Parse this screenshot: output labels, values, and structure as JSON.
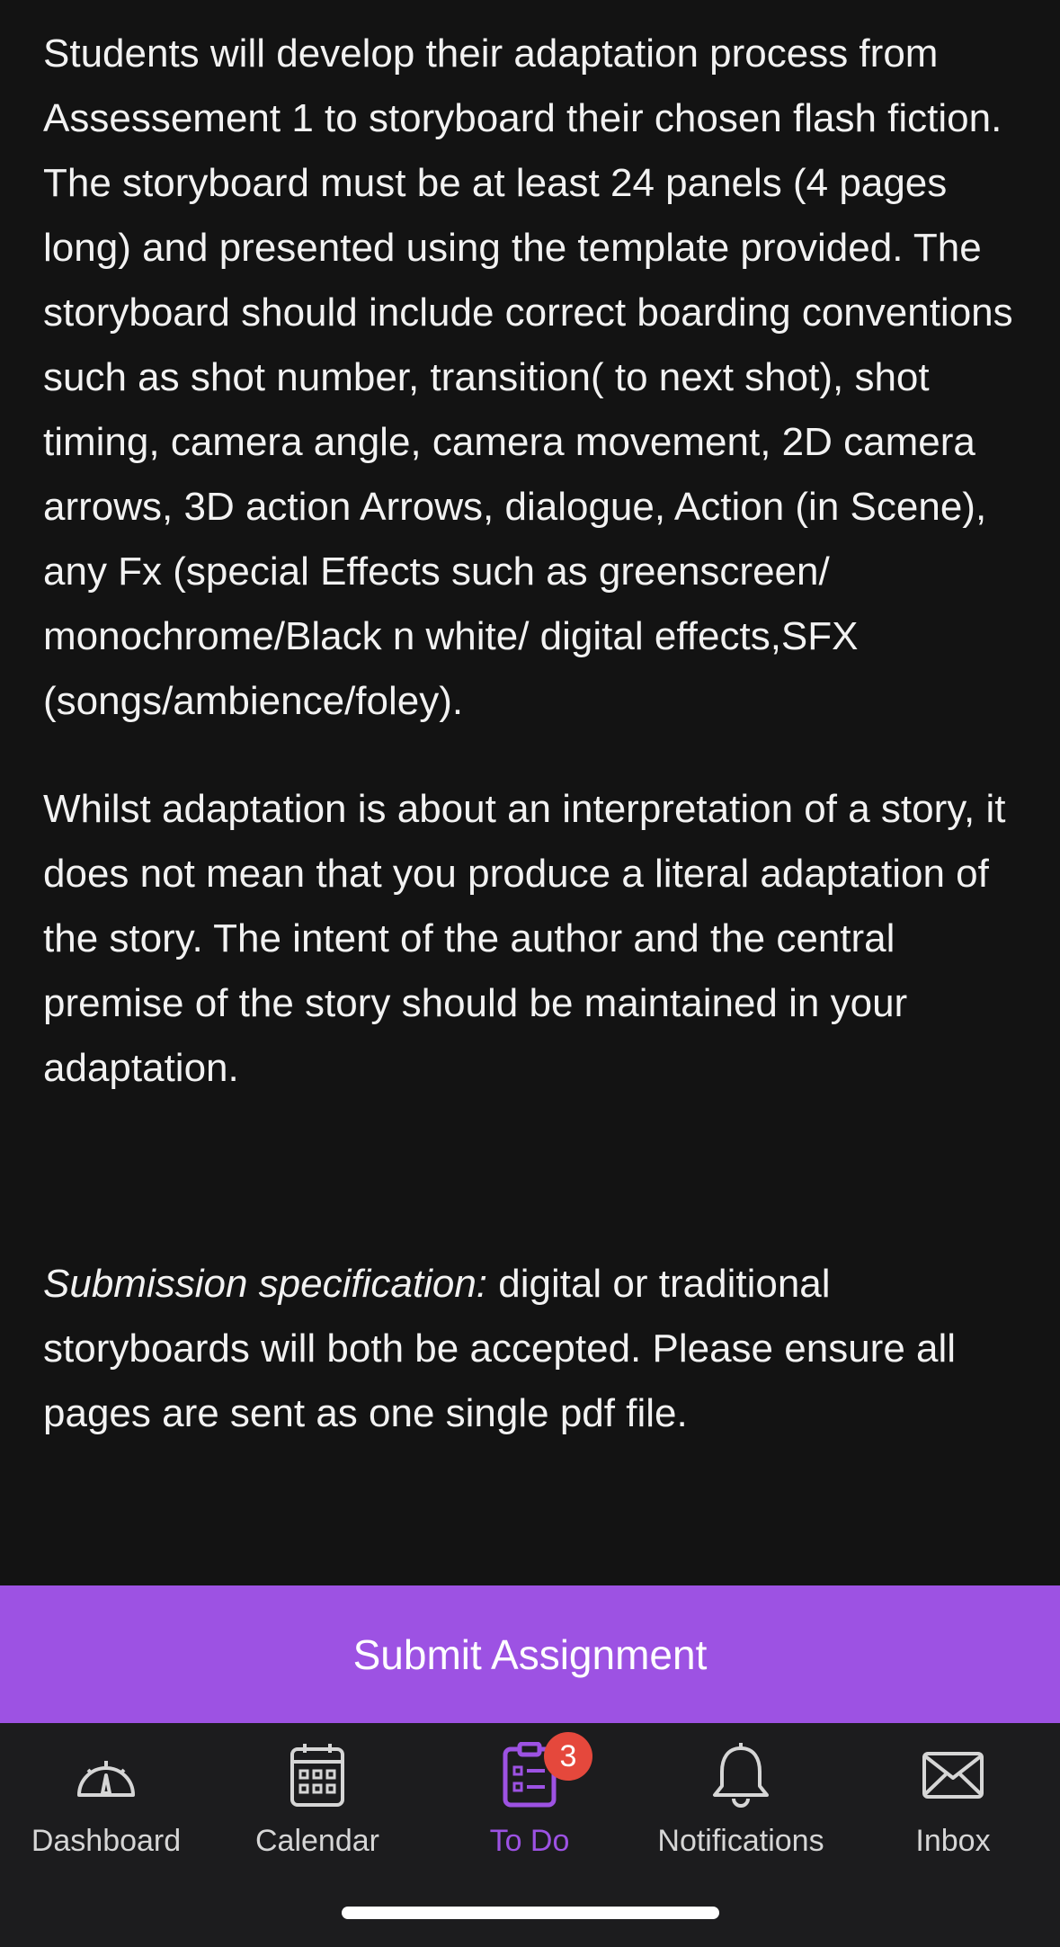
{
  "assignment": {
    "paragraph1": "Students will develop their adaptation process from Assessement 1 to storyboard their chosen flash fiction. The storyboard must be at least 24 panels (4 pages long) and presented using the template provided. The storyboard should include correct boarding conventions such as shot number, transition( to next shot), shot timing, camera angle, camera movement, 2D camera arrows, 3D action Arrows, dialogue, Action (in Scene), any Fx (special Effects such as greenscreen/ monochrome/Black n white/ digital effects,SFX (songs/ambience/foley).",
    "paragraph2": "Whilst adaptation is about an interpretation of a story, it does not mean that you produce a literal adaptation of the story. The intent of the author and the central premise of the story should be maintained in your adaptation.",
    "spec_label": "Submission specification:",
    "spec_text": " digital or traditional storyboards will both be accepted. Please ensure all pages are sent as one single pdf file."
  },
  "submit_button": {
    "label": "Submit Assignment"
  },
  "tabbar": {
    "tabs": [
      {
        "label": "Dashboard",
        "icon": "dashboard-icon",
        "active": false
      },
      {
        "label": "Calendar",
        "icon": "calendar-icon",
        "active": false
      },
      {
        "label": "To Do",
        "icon": "todo-icon",
        "active": true,
        "badge": "3"
      },
      {
        "label": "Notifications",
        "icon": "bell-icon",
        "active": false
      },
      {
        "label": "Inbox",
        "icon": "envelope-icon",
        "active": false
      }
    ]
  },
  "colors": {
    "background": "#131313",
    "accent": "#9d52e3",
    "badge": "#e5483c",
    "tabbar": "#1c1c1e"
  }
}
